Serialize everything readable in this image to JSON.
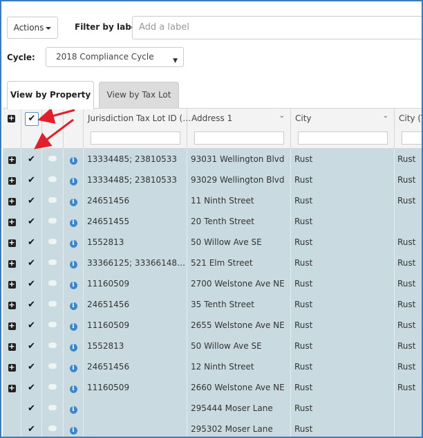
{
  "toolbar": {
    "actions_label": "Actions",
    "filter_label": "Filter by label:",
    "label_placeholder": "Add a label",
    "cycle_label": "Cycle:",
    "cycle_value": "2018 Compliance Cycle"
  },
  "tabs": [
    {
      "label": "View by Property",
      "active": true
    },
    {
      "label": "View by Tax Lot",
      "active": false
    }
  ],
  "columns": {
    "jurisdiction": "Jurisdiction Tax Lot ID (…",
    "address": "Address 1",
    "city": "City",
    "city_taxlot": "City (Ta"
  },
  "rows": [
    {
      "tax_lot": "13334485; 23810533",
      "address": "93031 Wellington Blvd",
      "city": "Rust",
      "city2": "Rust",
      "expandable": true
    },
    {
      "tax_lot": "13334485; 23810533",
      "address": "93029 Wellington Blvd",
      "city": "Rust",
      "city2": "Rust",
      "expandable": true
    },
    {
      "tax_lot": "24651456",
      "address": "11 Ninth Street",
      "city": "Rust",
      "city2": "Rust",
      "expandable": true
    },
    {
      "tax_lot": "24651455",
      "address": "20 Tenth Street",
      "city": "Rust",
      "city2": "",
      "expandable": true
    },
    {
      "tax_lot": "1552813",
      "address": "50 Willow Ave SE",
      "city": "Rust",
      "city2": "Rust",
      "expandable": true
    },
    {
      "tax_lot": "33366125; 33366148; …",
      "address": "521 Elm Street",
      "city": "Rust",
      "city2": "Rust",
      "expandable": true
    },
    {
      "tax_lot": "11160509",
      "address": "2700 Welstone Ave NE",
      "city": "Rust",
      "city2": "Rust",
      "expandable": true
    },
    {
      "tax_lot": "24651456",
      "address": "35 Tenth Street",
      "city": "Rust",
      "city2": "Rust",
      "expandable": true
    },
    {
      "tax_lot": "11160509",
      "address": "2655 Welstone Ave NE",
      "city": "Rust",
      "city2": "Rust",
      "expandable": true
    },
    {
      "tax_lot": "1552813",
      "address": "50 Willow Ave SE",
      "city": "Rust",
      "city2": "Rust",
      "expandable": true
    },
    {
      "tax_lot": "24651456",
      "address": "12 Ninth Street",
      "city": "Rust",
      "city2": "Rust",
      "expandable": true
    },
    {
      "tax_lot": "11160509",
      "address": "2660 Welstone Ave NE",
      "city": "Rust",
      "city2": "Rust",
      "expandable": true
    },
    {
      "tax_lot": "",
      "address": "295444 Moser Lane",
      "city": "Rust",
      "city2": "",
      "expandable": false
    },
    {
      "tax_lot": "",
      "address": "295302 Moser Lane",
      "city": "Rust",
      "city2": "",
      "expandable": false
    }
  ],
  "colors": {
    "selected_row": "#c9dbe0",
    "annotation_arrow": "#e0202a",
    "info_icon": "#3b87c8"
  },
  "icons": {
    "expand": "plus-square-icon",
    "check": "checkmark-icon",
    "note": "speech-bubble-icon",
    "info": "info-circle-icon"
  }
}
